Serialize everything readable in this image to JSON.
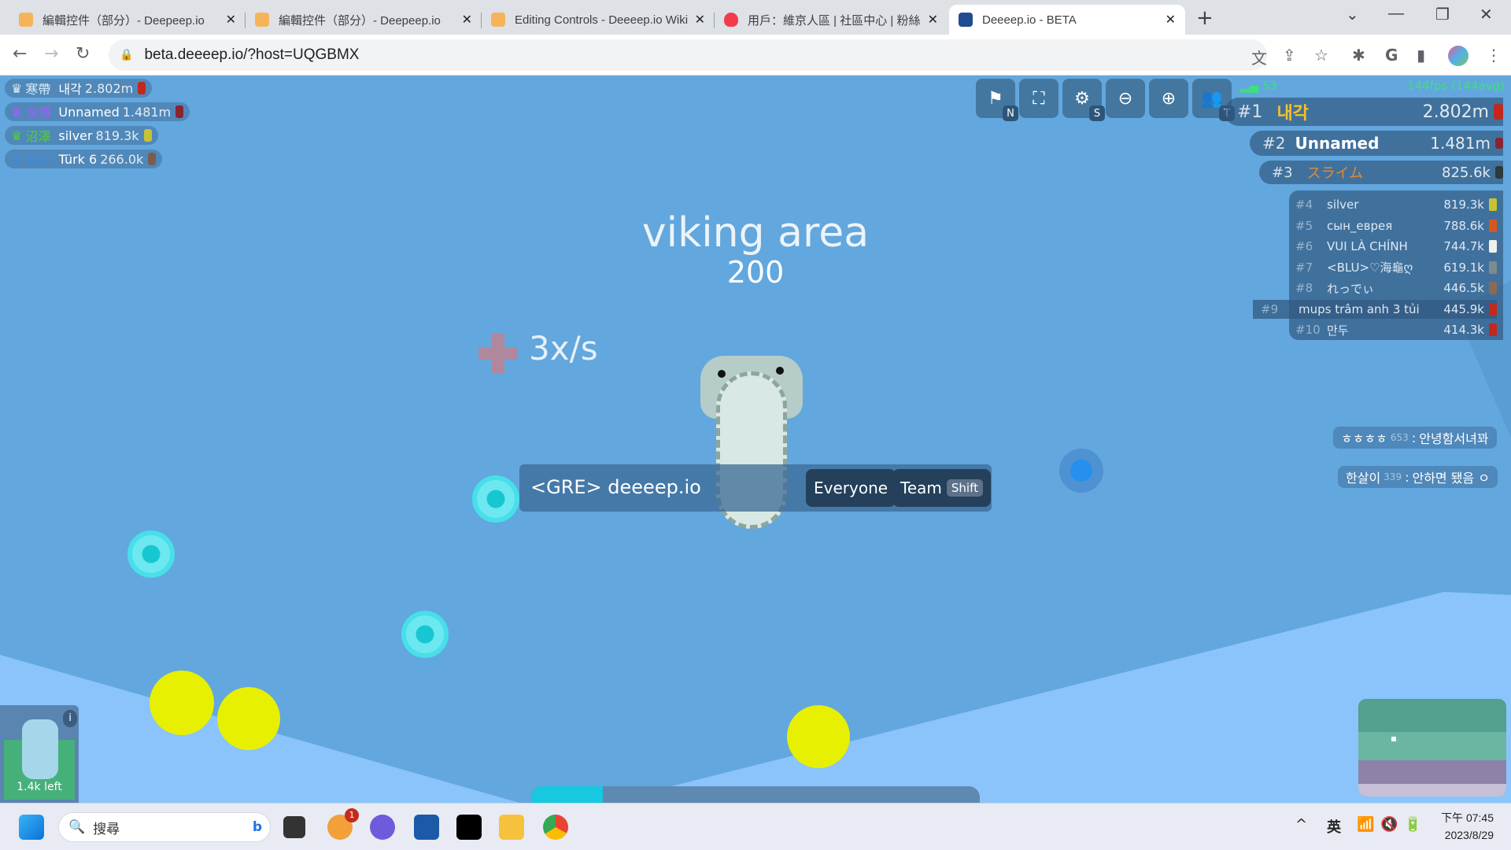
{
  "browser": {
    "tabs": [
      {
        "title": "編輯控件（部分）- Deepeep.io",
        "favicon": "deeeep-fish-icon",
        "active": false
      },
      {
        "title": "編輯控件（部分）- Deepeep.io",
        "favicon": "deeeep-fish-icon",
        "active": false
      },
      {
        "title": "Editing Controls - Deeeep.io Wiki",
        "favicon": "deeeep-fish-icon",
        "active": false
      },
      {
        "title": "用戶：維京人區 | 社區中心 | 粉絲",
        "favicon": "fandom-flame-icon",
        "active": false
      },
      {
        "title": "Deeeep.io - BETA",
        "favicon": "deeeep-beta-icon",
        "active": true
      }
    ],
    "url": "beta.deeeep.io/?host=UQGBMX"
  },
  "game": {
    "top_left_leaderboard": [
      {
        "tribe": "寒帶",
        "tribe_color": "#d9eefc",
        "name": "내각",
        "score": "2.802m",
        "animal_color": "#c2281e"
      },
      {
        "tribe": "深海",
        "tribe_color": "#a55cff",
        "name": "Unnamed",
        "score": "1.481m",
        "animal_color": "#8b2430"
      },
      {
        "tribe": "沼澤",
        "tribe_color": "#4fcc40",
        "name": "silver",
        "score": "819.3k",
        "animal_color": "#c6c234"
      },
      {
        "tribe": "海洋",
        "tribe_color": "#3f8ae0",
        "name": "Türk 6",
        "score": "266.0k",
        "animal_color": "#7b5d4f"
      }
    ],
    "controls": [
      {
        "icon": "map-search-icon",
        "key": "N"
      },
      {
        "icon": "fullscreen-icon",
        "key": ""
      },
      {
        "icon": "settings-gear-icon",
        "key": "S"
      },
      {
        "icon": "zoom-out-icon",
        "key": ""
      },
      {
        "icon": "zoom-in-icon",
        "key": ""
      },
      {
        "icon": "team-people-icon",
        "key": "T"
      }
    ],
    "ping": "53",
    "fps": "144fps (144avg)",
    "leaderboard_top": [
      {
        "rank": "#1",
        "name": "내각",
        "score": "2.802m",
        "name_color": "#f5c12a",
        "animal_color": "#c2281e"
      },
      {
        "rank": "#2",
        "name": "Unnamed",
        "score": "1.481m",
        "name_color": "#ffffff",
        "animal_color": "#8b2430"
      },
      {
        "rank": "#3",
        "name": "スライム",
        "score": "825.6k",
        "name_color": "#e88a2a",
        "animal_color": "#2c3a3a"
      }
    ],
    "leaderboard_rest": [
      {
        "rank": "#4",
        "name": "silver",
        "score": "819.3k",
        "animal_color": "#c6c234"
      },
      {
        "rank": "#5",
        "name": "сын_еврея",
        "score": "788.6k",
        "animal_color": "#d8571e"
      },
      {
        "rank": "#6",
        "name": "VUI LÀ CHÍNH",
        "score": "744.7k",
        "animal_color": "#f0f0f0"
      },
      {
        "rank": "#7",
        "name": "<BLU>♡海龜ღ",
        "score": "619.1k",
        "animal_color": "#7f8a8c"
      },
      {
        "rank": "#8",
        "name": "れっでぃ",
        "score": "446.5k",
        "animal_color": "#8a6a55"
      },
      {
        "rank": "#9",
        "name": "mups trâm anh 3 tủi",
        "score": "445.9k",
        "animal_color": "#c2281e",
        "is_self": true
      },
      {
        "rank": "#10",
        "name": "만두",
        "score": "414.3k",
        "animal_color": "#c2281e"
      }
    ],
    "area_name": "viking area",
    "area_value": "200",
    "rate_text": "3x/s",
    "chat": {
      "input_value": "<GRE> deeeep.io",
      "everyone_label": "Everyone",
      "team_label": "Team",
      "team_key": "Shift"
    },
    "chat_messages": [
      {
        "name": "ㅎㅎㅎㅎ",
        "level": "653",
        "text": "안녕함서녀꽈"
      },
      {
        "name": "한살이",
        "level": "339",
        "text": "안하면 됐음 ㅇ"
      }
    ],
    "xp_progress_fraction": 0.16,
    "boost": {
      "remaining": "1.4k left",
      "info_label": "i"
    }
  },
  "taskbar": {
    "search_placeholder": "搜尋",
    "notification_badge": "1",
    "ime": "英",
    "time": "下午 07:45",
    "date": "2023/8/29"
  }
}
